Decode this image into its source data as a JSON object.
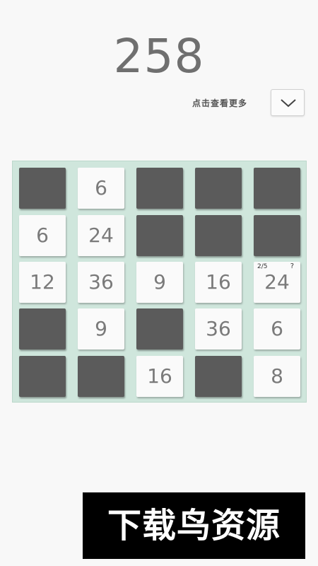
{
  "score": "258",
  "more": {
    "label": "点击查看更多",
    "icon": "chevron-down-icon"
  },
  "colors": {
    "board_bg": "#cfe6dc",
    "dark_tile": "#5b5b5b",
    "light_tile": "#fafafa",
    "text": "#7a7a7a"
  },
  "grid": [
    [
      "",
      "6",
      "",
      "",
      ""
    ],
    [
      "6",
      "24",
      "",
      "",
      ""
    ],
    [
      "12",
      "36",
      "9",
      "16",
      "24"
    ],
    [
      "",
      "9",
      "",
      "36",
      "6"
    ],
    [
      "",
      "",
      "16",
      "",
      "8"
    ]
  ],
  "hint": {
    "progress": "2/5",
    "help": "?"
  },
  "banner": {
    "text": "下载鸟资源"
  }
}
